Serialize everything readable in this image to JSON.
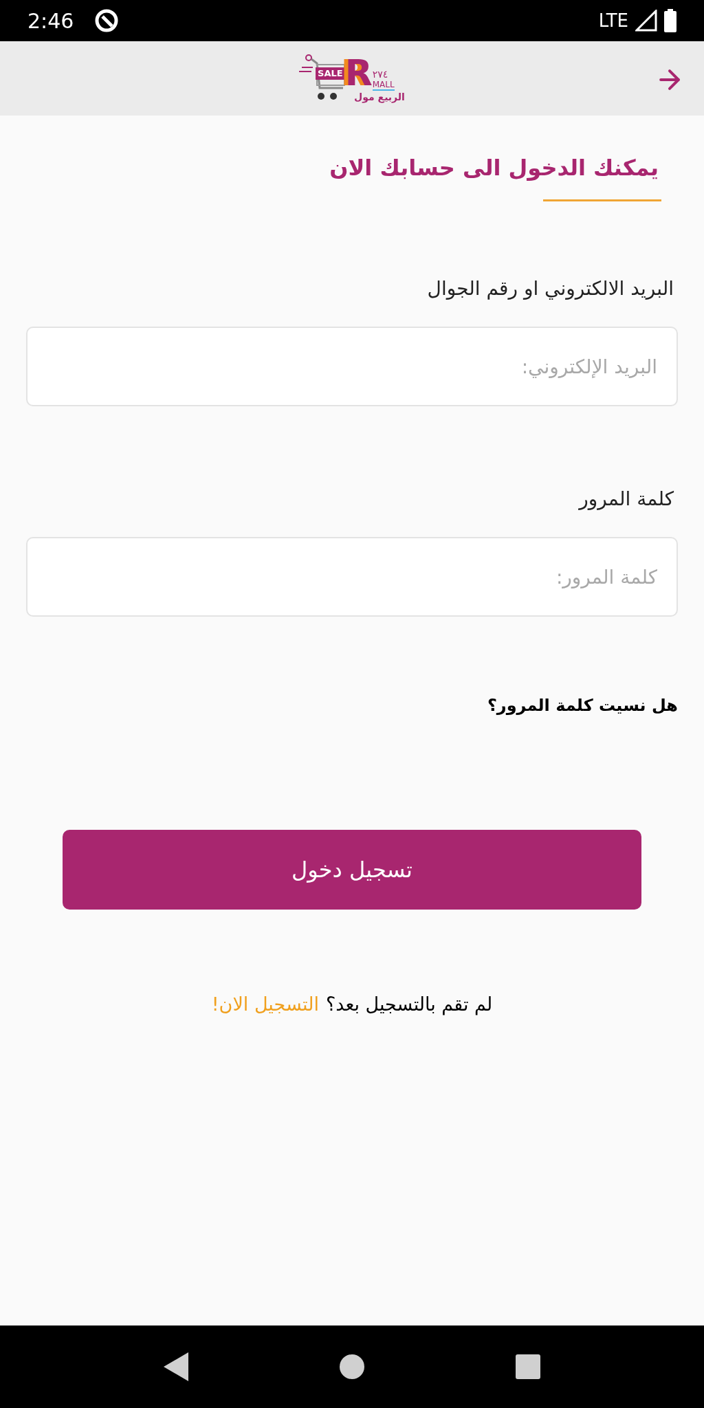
{
  "status_bar": {
    "time": "2:46",
    "network": "LTE"
  },
  "header": {
    "logo": {
      "sale": "SALE",
      "letter": "R",
      "digits": "٢٧٤",
      "mall": "MALL",
      "arabic_name": "الربيع مول"
    }
  },
  "title": "يمكنك الدخول الى حسابك الان",
  "fields": [
    {
      "label": "البريد الالكتروني او رقم الجوال",
      "placeholder": "البريد الإلكتروني:"
    },
    {
      "label": "كلمة المرور",
      "placeholder": "كلمة المرور:"
    }
  ],
  "forgot_link": "هل نسيت كلمة المرور؟",
  "login_button": "تسجيل دخول",
  "signup": {
    "prompt": "لم تقم بالتسجيل بعد؟",
    "link": "التسجيل الان!"
  }
}
